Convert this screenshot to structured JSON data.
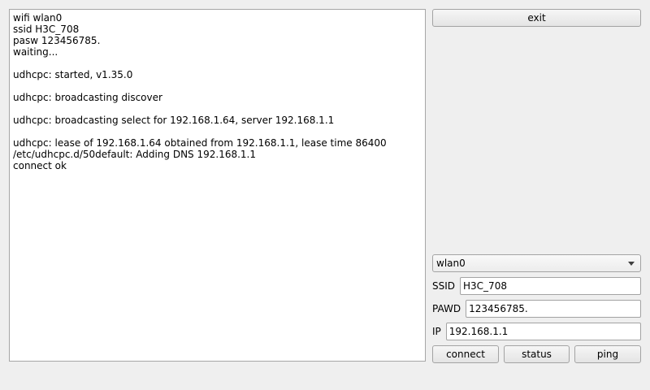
{
  "log": {
    "lines": [
      "wifi wlan0",
      "ssid H3C_708",
      "pasw 123456785.",
      "waiting...",
      "",
      "udhcpc: started, v1.35.0",
      "",
      "udhcpc: broadcasting discover",
      "",
      "udhcpc: broadcasting select for 192.168.1.64, server 192.168.1.1",
      "",
      "udhcpc: lease of 192.168.1.64 obtained from 192.168.1.1, lease time 86400",
      "/etc/udhcpc.d/50default: Adding DNS 192.168.1.1",
      "connect ok"
    ]
  },
  "buttons": {
    "exit": "exit",
    "connect": "connect",
    "status": "status",
    "ping": "ping"
  },
  "interface": {
    "selected": "wlan0"
  },
  "ssid": {
    "label": "SSID",
    "value": "H3C_708"
  },
  "password": {
    "label": "PAWD",
    "value": "123456785."
  },
  "ip": {
    "label": "IP",
    "value": "192.168.1.1"
  }
}
